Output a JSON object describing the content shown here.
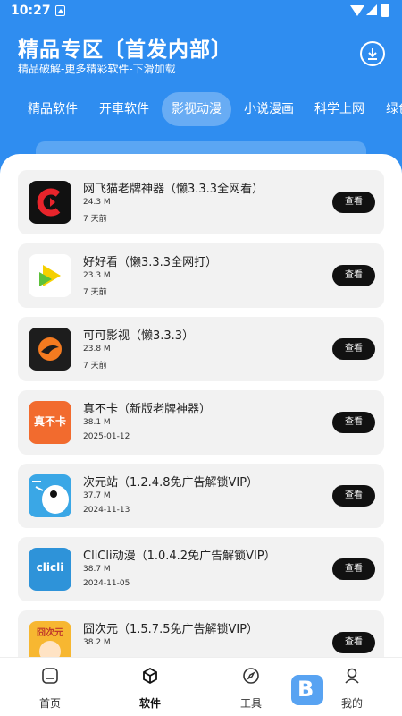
{
  "status_bar": {
    "time": "10:27"
  },
  "header": {
    "title": "精品专区〔首发内部〕",
    "subtitle": "精品破解-更多精彩软件-下滑加载",
    "download_icon": "download-icon"
  },
  "tabs": [
    {
      "label": "精品软件",
      "active": false
    },
    {
      "label": "开車软件",
      "active": false
    },
    {
      "label": "影视动漫",
      "active": true
    },
    {
      "label": "小说漫画",
      "active": false
    },
    {
      "label": "科学上网",
      "active": false
    },
    {
      "label": "绿色",
      "active": false
    }
  ],
  "apps": [
    {
      "title": "网飞猫老牌神器（懒3.3.3全网看）",
      "size": "24.3 M",
      "date": "7 天前",
      "button": "查看"
    },
    {
      "title": "好好看（懒3.3.3全网打）",
      "size": "23.3 M",
      "date": "7 天前",
      "button": "查看"
    },
    {
      "title": "可可影视（懒3.3.3）",
      "size": "23.8 M",
      "date": "7 天前",
      "button": "查看"
    },
    {
      "title": "真不卡（新版老牌神器）",
      "size": "38.1 M",
      "date": "2025-01-12",
      "button": "查看"
    },
    {
      "title": "次元站（1.2.4.8免广告解锁VIP）",
      "size": "37.7 M",
      "date": "2024-11-13",
      "button": "查看"
    },
    {
      "title": "CliCli动漫（1.0.4.2免广告解锁VIP）",
      "size": "38.7 M",
      "date": "2024-11-05",
      "button": "查看"
    },
    {
      "title": "囧次元（1.5.7.5免广告解锁VIP）",
      "size": "38.2 M",
      "date": "",
      "button": "查看"
    }
  ],
  "icon_text": {
    "zhenbuka": "真不卡",
    "clicli": "clicli",
    "jiong": "囧次元"
  },
  "bottom_nav": [
    {
      "label": "首页",
      "icon": "home-icon",
      "active": false
    },
    {
      "label": "软件",
      "icon": "software-icon",
      "active": true
    },
    {
      "label": "工具",
      "icon": "compass-icon",
      "active": false
    },
    {
      "label": "我的",
      "icon": "profile-icon",
      "active": false
    }
  ],
  "colors": {
    "primary": "#2f8df0",
    "button": "#111111",
    "card": "#f2f2f2"
  }
}
